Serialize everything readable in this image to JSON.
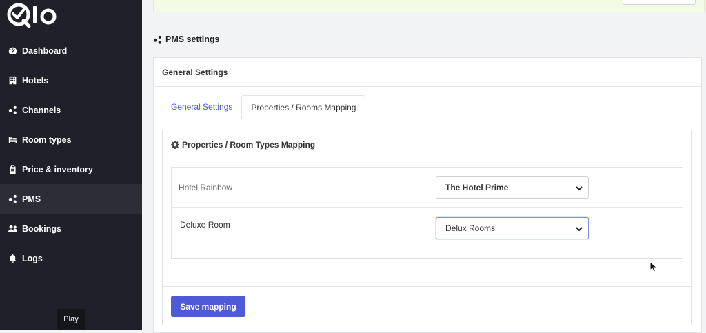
{
  "app": {
    "logo_text": "Qlo"
  },
  "sidebar": {
    "items": [
      {
        "label": "Dashboard",
        "icon": "gauge-icon"
      },
      {
        "label": "Hotels",
        "icon": "building-icon"
      },
      {
        "label": "Channels",
        "icon": "share-nodes-icon"
      },
      {
        "label": "Room types",
        "icon": "bed-icon"
      },
      {
        "label": "Price & inventory",
        "icon": "clipboard-icon"
      },
      {
        "label": "PMS",
        "icon": "share-nodes-icon"
      },
      {
        "label": "Bookings",
        "icon": "users-icon"
      },
      {
        "label": "Logs",
        "icon": "bell-icon"
      }
    ],
    "active": "PMS"
  },
  "tooltip": {
    "text": "Play"
  },
  "page": {
    "title": "PMS settings"
  },
  "card": {
    "title": "General Settings",
    "tabs": [
      {
        "label": "General Settings"
      },
      {
        "label": "Properties / Rooms Mapping"
      }
    ],
    "active_tab": "Properties / Rooms Mapping"
  },
  "mapping": {
    "title": "Properties / Room Types Mapping",
    "rows": [
      {
        "label": "Hotel Rainbow",
        "selected": "The Hotel Prime"
      },
      {
        "label": "Deluxe Room",
        "selected": "Delux Rooms"
      }
    ],
    "save_label": "Save mapping"
  },
  "colors": {
    "sidebar_bg": "#1f2029",
    "accent": "#4e5ad8",
    "banner_bg": "#f3fbe5"
  }
}
